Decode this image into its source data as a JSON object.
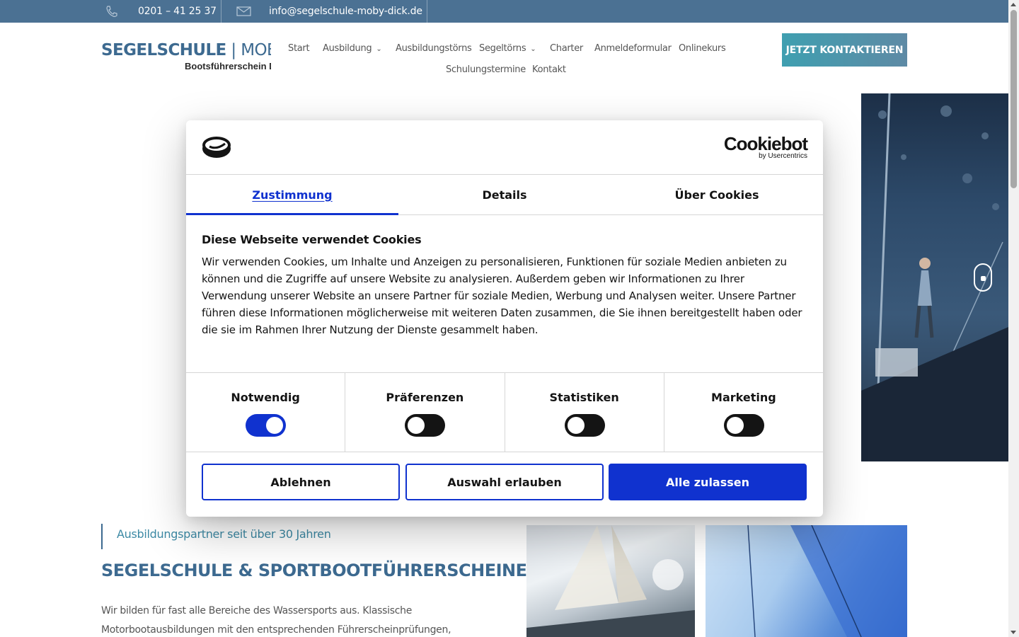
{
  "topbar": {
    "phone": "0201 – 41 25 37",
    "email": "info@segelschule-moby-dick.de"
  },
  "header": {
    "logo_main": "SEGELSCHULE",
    "logo_sep": " | MOBY",
    "logo_sub": "Bootsführerschein D",
    "cta_label": "JETZT KONTAKTIEREN"
  },
  "nav": {
    "items": [
      {
        "label": "Start"
      },
      {
        "label": "Ausbildung"
      },
      {
        "label": "Ausbildungstörns"
      },
      {
        "label": "Segeltörns"
      },
      {
        "label": "Charter"
      },
      {
        "label": "Anmeldeformular"
      },
      {
        "label": "Onlinekurs"
      },
      {
        "label": "Schulungstermine"
      },
      {
        "label": "Kontakt"
      }
    ]
  },
  "content": {
    "kicker": "Ausbildungspartner seit über 30 Jahren",
    "heading": "SEGELSCHULE & SPORTBOOTFÜHRERSCHEINE",
    "paragraph": "Wir bilden für fast alle Bereiche des Wassersports aus. Klassische Motorbootausbildungen mit den entsprechenden Führerscheinprüfungen,"
  },
  "cookie": {
    "brand_main": "Cookiebot",
    "brand_sub": "by Usercentrics",
    "tabs": [
      {
        "label": "Zustimmung",
        "active": true
      },
      {
        "label": "Details",
        "active": false
      },
      {
        "label": "Über Cookies",
        "active": false
      }
    ],
    "title": "Diese Webseite verwendet Cookies",
    "text": "Wir verwenden Cookies, um Inhalte und Anzeigen zu personalisieren, Funktionen für soziale Medien anbieten zu können und die Zugriffe auf unsere Website zu analysieren. Außerdem geben wir Informationen zu Ihrer Verwendung unserer Website an unsere Partner für soziale Medien, Werbung und Analysen weiter. Unsere Partner führen diese Informationen möglicherweise mit weiteren Daten zusammen, die Sie ihnen bereitgestellt haben oder die sie im Rahmen Ihrer Nutzung der Dienste gesammelt haben.",
    "toggles": [
      {
        "label": "Notwendig",
        "on": true
      },
      {
        "label": "Präferenzen",
        "on": false
      },
      {
        "label": "Statistiken",
        "on": false
      },
      {
        "label": "Marketing",
        "on": false
      }
    ],
    "buttons": {
      "reject": "Ablehnen",
      "allow_selection": "Auswahl erlauben",
      "allow_all": "Alle zulassen"
    }
  },
  "colors": {
    "topbar": "#4b7193",
    "brand": "#3d6a90",
    "cookie_accent": "#1032cf"
  }
}
